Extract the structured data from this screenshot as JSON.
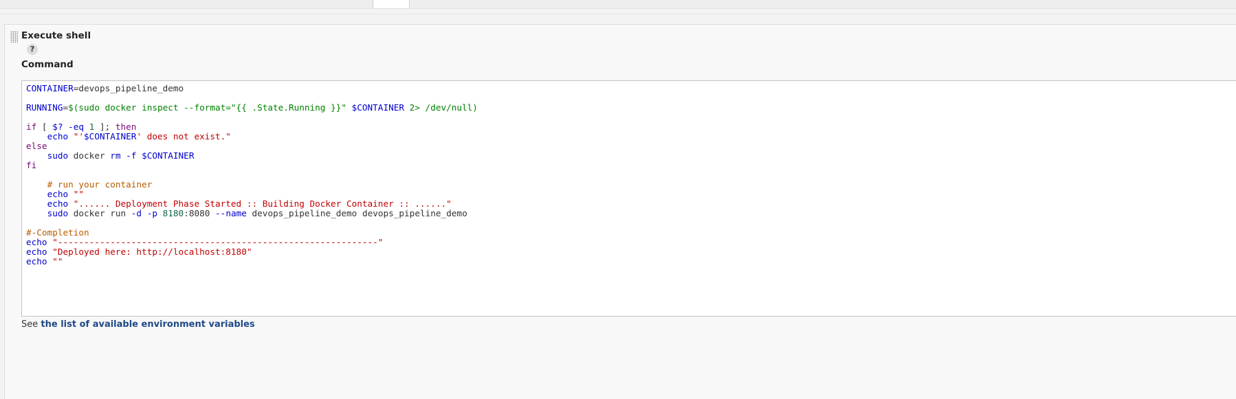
{
  "step": {
    "title": "Execute shell",
    "help_icon": "?",
    "command_label": "Command"
  },
  "script_lines": [
    [
      [
        "CONTAINER",
        "var"
      ],
      [
        "=devops_pipeline_demo",
        "def"
      ]
    ],
    [],
    [
      [
        "RUNNING",
        "var"
      ],
      [
        "=",
        "def"
      ],
      [
        "$(sudo docker inspect --format=\"{{ .State.Running }}\" ",
        "sub"
      ],
      [
        "$CONTAINER",
        "var"
      ],
      [
        " 2> /dev/null)",
        "sub"
      ]
    ],
    [],
    [
      [
        "if",
        "kw"
      ],
      [
        " [ ",
        "def"
      ],
      [
        "$?",
        "var"
      ],
      [
        " ",
        "def"
      ],
      [
        "-eq",
        "var"
      ],
      [
        " ",
        "def"
      ],
      [
        "1",
        "num"
      ],
      [
        " ]; ",
        "def"
      ],
      [
        "then",
        "kw"
      ]
    ],
    [
      [
        "    ",
        "def"
      ],
      [
        "echo",
        "var"
      ],
      [
        " ",
        "def"
      ],
      [
        "\"'",
        "str"
      ],
      [
        "$CONTAINER",
        "var"
      ],
      [
        "' does not exist.\"",
        "str"
      ]
    ],
    [
      [
        "else",
        "kw"
      ]
    ],
    [
      [
        "    ",
        "def"
      ],
      [
        "sudo",
        "var"
      ],
      [
        " docker ",
        "def"
      ],
      [
        "rm",
        "var"
      ],
      [
        " ",
        "def"
      ],
      [
        "-f",
        "var"
      ],
      [
        " ",
        "def"
      ],
      [
        "$CONTAINER",
        "var"
      ]
    ],
    [
      [
        "fi",
        "kw"
      ]
    ],
    [],
    [
      [
        "    ",
        "def"
      ],
      [
        "# run your container",
        "cmt"
      ]
    ],
    [
      [
        "    ",
        "def"
      ],
      [
        "echo",
        "var"
      ],
      [
        " ",
        "def"
      ],
      [
        "\"\"",
        "str"
      ]
    ],
    [
      [
        "    ",
        "def"
      ],
      [
        "echo",
        "var"
      ],
      [
        " ",
        "def"
      ],
      [
        "\"...... Deployment Phase Started :: Building Docker Container :: ......\"",
        "str"
      ]
    ],
    [
      [
        "    ",
        "def"
      ],
      [
        "sudo",
        "var"
      ],
      [
        " docker run ",
        "def"
      ],
      [
        "-d",
        "var"
      ],
      [
        " ",
        "def"
      ],
      [
        "-p",
        "var"
      ],
      [
        " ",
        "def"
      ],
      [
        "8180",
        "num"
      ],
      [
        ":8080 ",
        "def"
      ],
      [
        "--name",
        "var"
      ],
      [
        " devops_pipeline_demo devops_pipeline_demo",
        "def"
      ]
    ],
    [],
    [
      [
        "#-Completion",
        "cmt"
      ]
    ],
    [
      [
        "echo",
        "var"
      ],
      [
        " ",
        "def"
      ],
      [
        "\"-------------------------------------------------------------\"",
        "str"
      ]
    ],
    [
      [
        "echo",
        "var"
      ],
      [
        " ",
        "def"
      ],
      [
        "\"Deployed here: http://localhost:8180\"",
        "str"
      ]
    ],
    [
      [
        "echo",
        "var"
      ],
      [
        " ",
        "def"
      ],
      [
        "\"\"",
        "str"
      ]
    ]
  ],
  "env_note": {
    "prefix": "See ",
    "link": "the list of available environment variables"
  },
  "colors": {
    "variable": "#0000cc",
    "keyword": "#7a0874",
    "string": "#c00000",
    "substitution": "#008000",
    "number": "#116644",
    "comment": "#b85c00",
    "link": "#204a87"
  }
}
